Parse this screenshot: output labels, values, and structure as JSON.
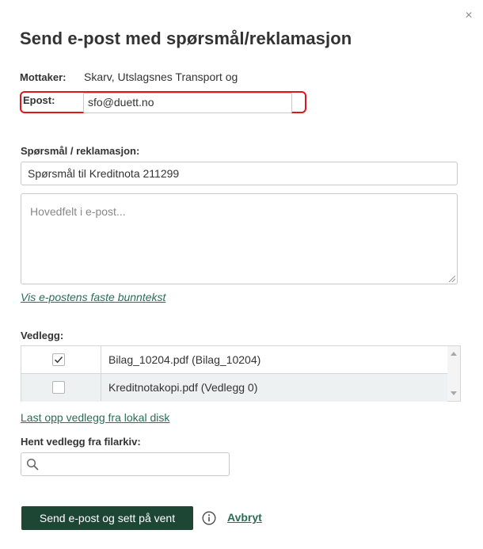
{
  "dialog": {
    "title": "Send e-post med spørsmål/reklamasjon",
    "close_label": "×"
  },
  "recipient": {
    "label": "Mottaker:",
    "value": "Skarv, Utslagsnes Transport og"
  },
  "email": {
    "label": "Epost:",
    "value": "sfo@duett.no",
    "highlight_color": "#e0161a"
  },
  "question": {
    "label": "Spørsmål / reklamasjon:",
    "subject_value": "Spørsmål til Kreditnota 211299",
    "body_placeholder": "Hovedfelt i e-post..."
  },
  "footer_link": "Vis e-postens faste bunntekst",
  "attachments": {
    "label": "Vedlegg:",
    "items": [
      {
        "name": "Bilag_10204.pdf (Bilag_10204)",
        "checked": true
      },
      {
        "name": "Kreditnotakopi.pdf (Vedlegg 0)",
        "checked": false
      }
    ],
    "upload_link": "Last opp vedlegg fra lokal disk"
  },
  "archive": {
    "label": "Hent vedlegg fra filarkiv:",
    "search_placeholder": "",
    "search_icon": "search-icon"
  },
  "actions": {
    "send_label": "Send e-post og sett på vent",
    "cancel_label": "Avbryt",
    "info_icon": "info-icon",
    "primary_color": "#1e4634",
    "link_color": "#2a6e57"
  }
}
